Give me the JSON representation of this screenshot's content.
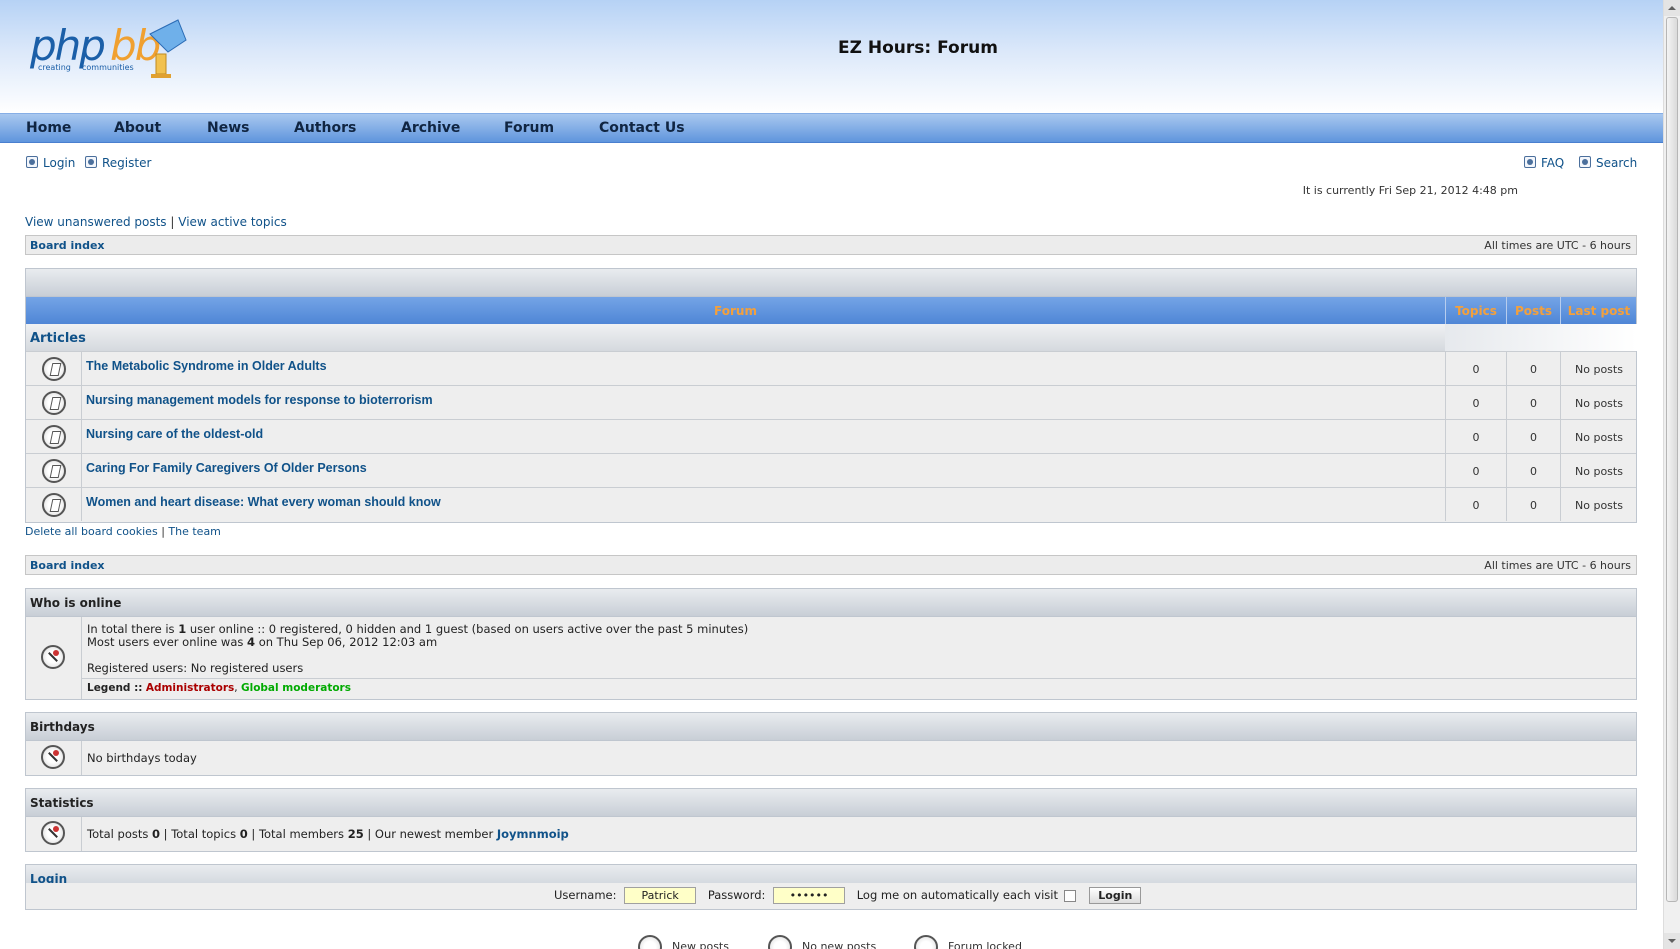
{
  "header": {
    "title": "EZ Hours: Forum",
    "logo_text_main": "phpbb",
    "logo_text_sub": "creating communities"
  },
  "nav": {
    "items": [
      "Home",
      "About",
      "News",
      "Authors",
      "Archive",
      "Forum",
      "Contact Us"
    ]
  },
  "userlinks": {
    "login": "Login",
    "register": "Register",
    "faq": "FAQ",
    "search": "Search"
  },
  "current_time": "It is currently Fri Sep 21, 2012 4:48 pm",
  "topic_links": {
    "unanswered": "View unanswered posts",
    "separator": "|",
    "active": "View active topics"
  },
  "breadcrumb": {
    "board_index": "Board index",
    "timezone": "All times are UTC - 6 hours"
  },
  "forum_table": {
    "headers": {
      "forum": "Forum",
      "topics": "Topics",
      "posts": "Posts",
      "last_post": "Last post"
    },
    "category": "Articles",
    "rows": [
      {
        "title": "The Metabolic Syndrome in Older Adults",
        "topics": "0",
        "posts": "0",
        "last_post": "No posts"
      },
      {
        "title": "Nursing management models for response to bioterrorism",
        "topics": "0",
        "posts": "0",
        "last_post": "No posts"
      },
      {
        "title": "Nursing care of the oldest-old",
        "topics": "0",
        "posts": "0",
        "last_post": "No posts"
      },
      {
        "title": "Caring For Family Caregivers Of Older Persons",
        "topics": "0",
        "posts": "0",
        "last_post": "No posts"
      },
      {
        "title": "Women and heart disease: What every woman should know",
        "topics": "0",
        "posts": "0",
        "last_post": "No posts"
      }
    ]
  },
  "bottom_links": {
    "delete_cookies": "Delete all board cookies",
    "separator": "|",
    "team": "The team"
  },
  "who_is_online": {
    "title": "Who is online",
    "line1_a": "In total there is ",
    "line1_count": "1",
    "line1_b": " user online :: 0 registered, 0 hidden and 1 guest (based on users active over the past 5 minutes)",
    "line2_a": "Most users ever online was ",
    "line2_count": "4",
    "line2_b": " on Thu Sep 06, 2012 12:03 am",
    "registered": "Registered users: No registered users",
    "legend_label": "Legend ::",
    "legend_admin": "Administrators",
    "legend_sep": ",",
    "legend_gmod": "Global moderators"
  },
  "birthdays": {
    "title": "Birthdays",
    "text": "No birthdays today"
  },
  "statistics": {
    "title": "Statistics",
    "total_posts_label": "Total posts ",
    "total_posts": "0",
    "sep1": " | ",
    "total_topics_label": "Total topics ",
    "total_topics": "0",
    "sep2": " | ",
    "total_members_label": "Total members ",
    "total_members": "25",
    "sep3": " | ",
    "newest_label": "Our newest member ",
    "newest_member": "Joymnmoip"
  },
  "login_panel": {
    "title": "Login",
    "username_label": "Username:",
    "username_value": "Patrick",
    "password_label": "Password:",
    "password_value": "••••••",
    "autologin_label": "Log me on automatically each visit",
    "submit": "Login"
  },
  "legend_icons": {
    "new_posts": "New posts",
    "no_new_posts": "No new posts",
    "forum_locked": "Forum locked"
  },
  "colors": {
    "nav_bar": "#5f95dd",
    "link": "#105289",
    "table_header_text": "#f3a03c",
    "admin": "#aa0000",
    "global_mod": "#00aa00",
    "input_bg": "#ffffc8"
  }
}
